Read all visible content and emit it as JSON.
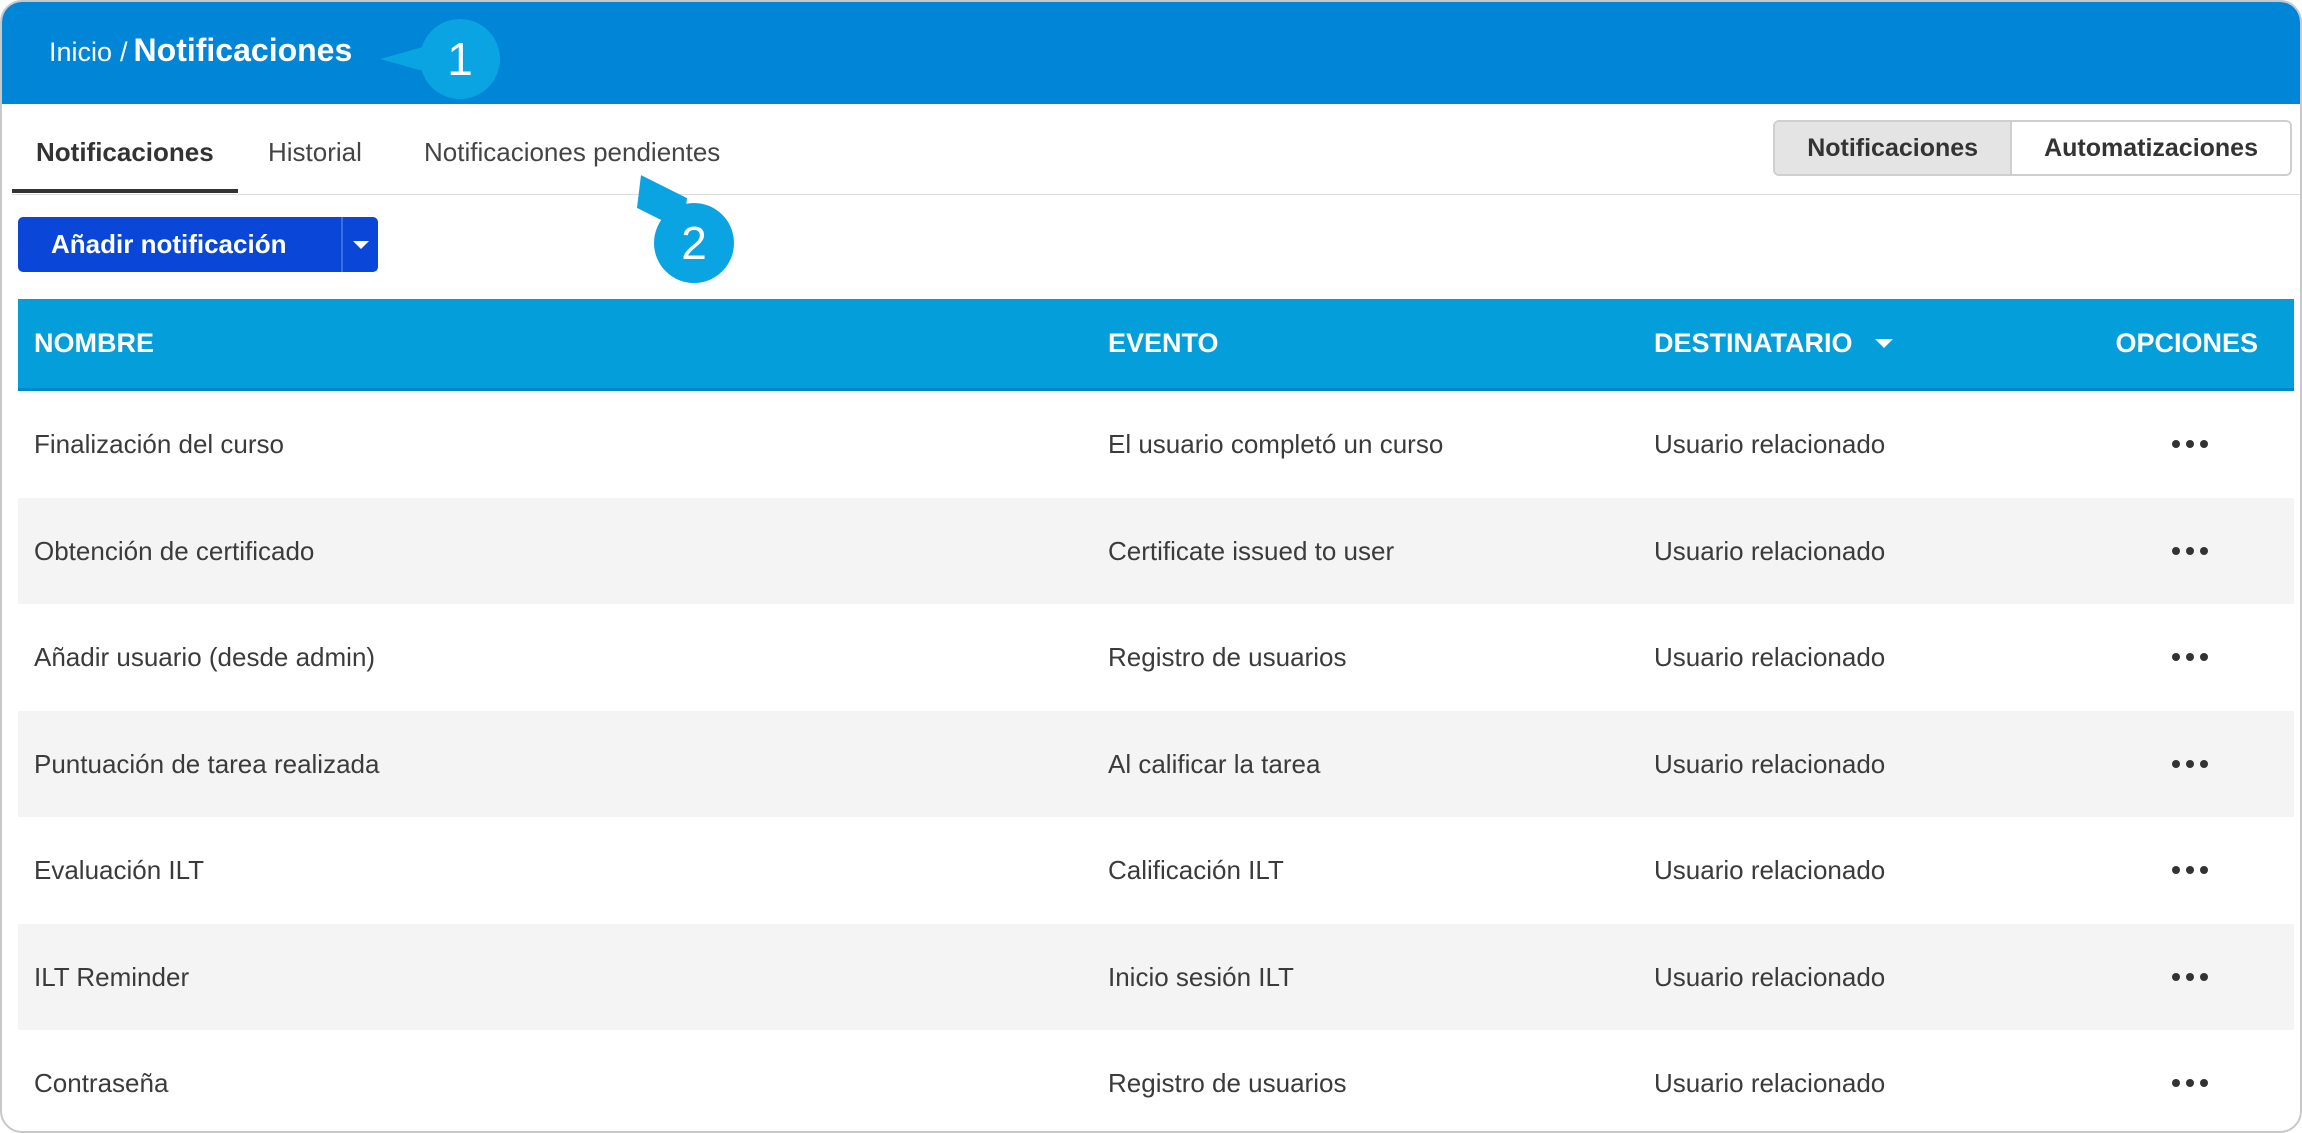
{
  "header": {
    "breadcrumb_home": "Inicio",
    "breadcrumb_separator": "/",
    "breadcrumb_current": "Notificaciones"
  },
  "callouts": [
    "1",
    "2"
  ],
  "tabs": [
    {
      "label": "Notificaciones",
      "active": true
    },
    {
      "label": "Historial",
      "active": false
    },
    {
      "label": "Notificaciones pendientes",
      "active": false
    }
  ],
  "view_toggle": {
    "notifications": "Notificaciones",
    "automations": "Automatizaciones"
  },
  "add_button": {
    "label": "Añadir notificación"
  },
  "table": {
    "columns": {
      "name": "NOMBRE",
      "event": "EVENTO",
      "recipient": "DESTINATARIO",
      "options": "OPCIONES"
    },
    "rows": [
      {
        "name": "Finalización del curso",
        "event": "El usuario completó un curso",
        "recipient": "Usuario relacionado"
      },
      {
        "name": "Obtención de certificado",
        "event": "Certificate issued to user",
        "recipient": "Usuario relacionado"
      },
      {
        "name": "Añadir usuario (desde admin)",
        "event": "Registro de usuarios",
        "recipient": "Usuario relacionado"
      },
      {
        "name": "Puntuación de tarea realizada",
        "event": "Al calificar la tarea",
        "recipient": "Usuario relacionado"
      },
      {
        "name": "Evaluación ILT",
        "event": "Calificación ILT",
        "recipient": "Usuario relacionado"
      },
      {
        "name": "ILT Reminder",
        "event": "Inicio sesión ILT",
        "recipient": "Usuario relacionado"
      },
      {
        "name": "Contraseña",
        "event": "Registro de usuarios",
        "recipient": "Usuario relacionado"
      }
    ]
  },
  "colors": {
    "header_bg": "#0085d7",
    "table_header_bg": "#049edb",
    "primary_button": "#0a46d8",
    "callout": "#0aa4e3"
  },
  "icons": {
    "row_options": "more-horizontal-icon",
    "sort": "caret-down-icon"
  }
}
